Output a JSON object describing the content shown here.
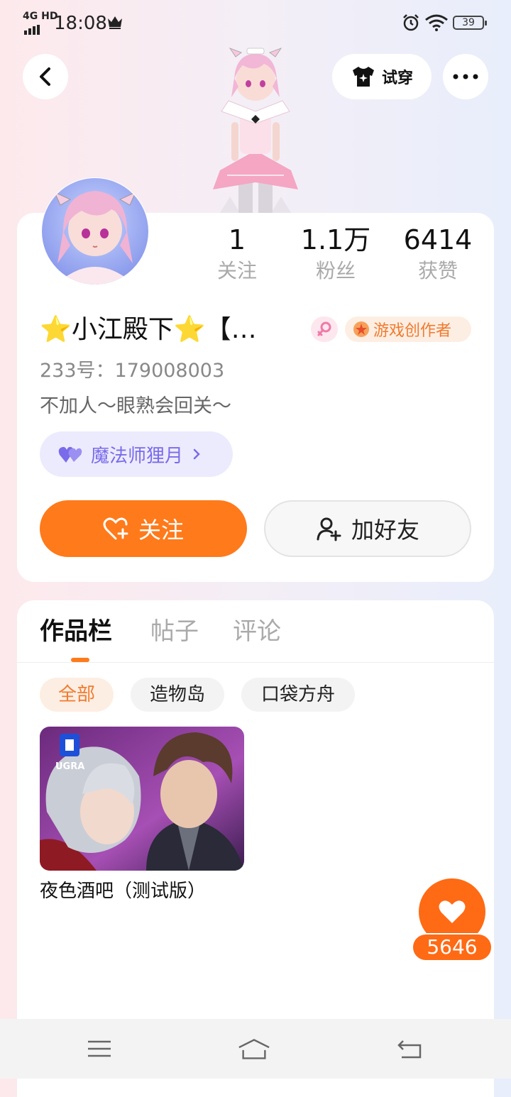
{
  "status_bar": {
    "network": "4G HD",
    "time": "18:08",
    "battery": "39"
  },
  "header": {
    "try_on_label": "试穿"
  },
  "profile": {
    "stats": [
      {
        "value": "1",
        "label": "关注"
      },
      {
        "value": "1.1万",
        "label": "粉丝"
      },
      {
        "value": "6414",
        "label": "获赞"
      }
    ],
    "nickname": "⭐小江殿下⭐【…",
    "creator_badge": "游戏创作者",
    "uid": "233号：179008003",
    "bio": "不加人～眼熟会回关～",
    "guild_label": "魔法师狸月",
    "follow_label": "关注",
    "add_friend_label": "加好友"
  },
  "works": {
    "tabs": [
      "作品栏",
      "帖子",
      "评论"
    ],
    "filters": [
      "全部",
      "造物岛",
      "口袋方舟"
    ],
    "items": [
      {
        "title": "夜色酒吧（测试版）",
        "thumb_logo": "UGRA"
      }
    ]
  },
  "like": {
    "count": "5646"
  },
  "colors": {
    "accent": "#ff7a1a",
    "guild": "#7a6bea",
    "creator": "#f07b2f"
  },
  "icons": [
    "back-arrow-icon",
    "tshirt-icon",
    "more-icon",
    "female-icon",
    "creator-icon",
    "heart-icon",
    "heart-plus-icon",
    "add-user-icon",
    "menu-icon",
    "home-icon",
    "back-icon"
  ]
}
